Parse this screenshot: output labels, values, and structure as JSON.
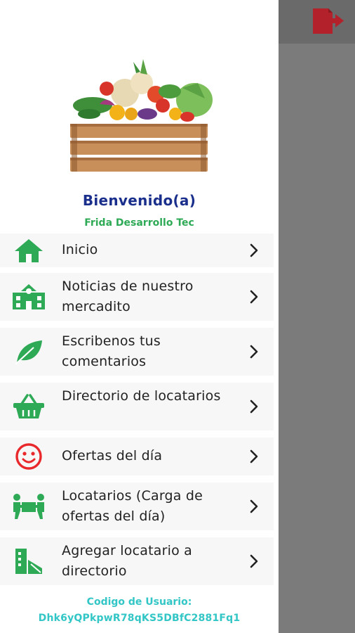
{
  "header": {
    "welcome": "Bienvenido(a)",
    "user_name": "Frida Desarrollo Tec"
  },
  "menu": {
    "items": [
      {
        "label": "Inicio",
        "icon": "home-icon"
      },
      {
        "label": "Noticias de nuestro mercadito",
        "icon": "school-building-icon"
      },
      {
        "label": "Escribenos tus comentarios",
        "icon": "leaf-icon"
      },
      {
        "label": "Directorio de locatarios",
        "icon": "basket-icon"
      },
      {
        "label": "Ofertas del día",
        "icon": "smiley-icon"
      },
      {
        "label": "Locatarios (Carga de ofertas del día)",
        "icon": "people-carrying-box-icon"
      },
      {
        "label": "Agregar locatario a directorio",
        "icon": "building-icon"
      }
    ]
  },
  "footer": {
    "code_title": "Codigo de Usuario:",
    "code_value": "Dhk6yQPkpwR78qKS5DBfC2881Fq1"
  },
  "colors": {
    "menu_icon": "#2eaa56",
    "smiley_icon": "#e8282b",
    "welcome": "#1a2f8c",
    "user_code": "#33c6c6",
    "logout_icon": "#b3222b"
  }
}
